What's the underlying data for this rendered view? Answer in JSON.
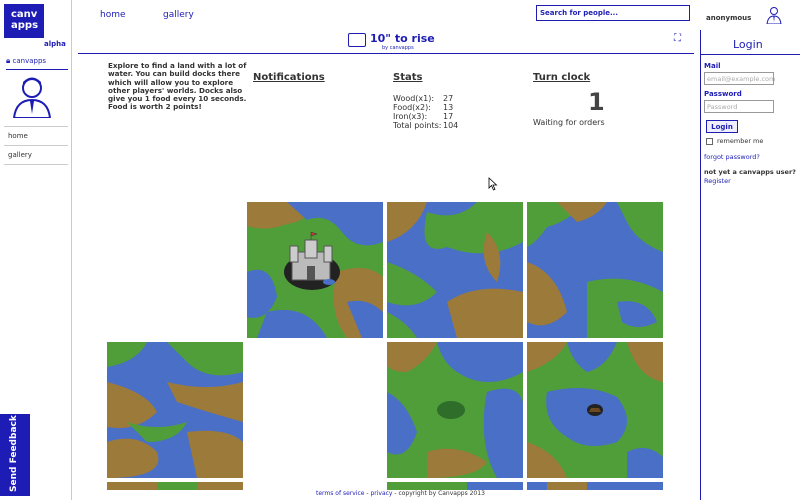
{
  "logo": {
    "line1": "canv",
    "line2": "apps",
    "tag": "alpha"
  },
  "left": {
    "user": "canvapps",
    "nav": [
      "home",
      "gallery"
    ]
  },
  "topnav": {
    "home": "home",
    "gallery": "gallery",
    "search_placeholder": "Search for people...",
    "user": "anonymous"
  },
  "app": {
    "title": "10\" to rise",
    "byline": "by canvapps"
  },
  "description": "Explore to find a land with a lot of water. You can build docks there which will allow you to explore other players' worlds. Docks also give you 1 food every 10 seconds. Food is worth 2 points!",
  "sections": {
    "notifications": "Notifications",
    "stats": "Stats",
    "turn_clock": "Turn clock"
  },
  "stats": [
    {
      "label": "Wood(x1):",
      "value": "27"
    },
    {
      "label": "Food(x2):",
      "value": "13"
    },
    {
      "label": "Iron(x3):",
      "value": "17"
    },
    {
      "label": "Total points:",
      "value": "104"
    }
  ],
  "clock": {
    "value": "1",
    "status": "Waiting for orders"
  },
  "login": {
    "title": "Login",
    "mail_label": "Mail",
    "mail_placeholder": "email@example.com",
    "password_label": "Password",
    "password_placeholder": "Password",
    "button": "Login",
    "remember": "remember me",
    "forgot": "forgot password?",
    "not_user": "not yet a canvapps user?",
    "register": "Register"
  },
  "feedback": "Send Feedback",
  "footer": {
    "terms": "terms of service",
    "sep": " - ",
    "privacy": "privacy",
    "copy": " - copyright by Canvapps 2013"
  },
  "colors": {
    "accent": "#1d1db5",
    "water": "#4a6fc7",
    "grass": "#4f9e3a",
    "dirt": "#9c7a3a"
  }
}
